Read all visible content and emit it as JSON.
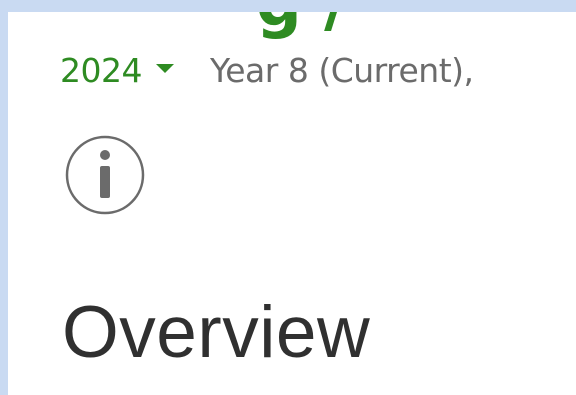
{
  "header": {
    "title_partial": "g  /"
  },
  "context": {
    "year": "2024",
    "caret_icon": "chevron-down-icon",
    "detail": "Year 8 (Current),"
  },
  "info": {
    "icon": "info-icon"
  },
  "section": {
    "heading": "Overview"
  },
  "colors": {
    "accent": "#2e8b22",
    "page_background": "#c9daf2",
    "panel": "#ffffff",
    "heading_text": "#303030",
    "muted_text": "#6b6b6b"
  }
}
